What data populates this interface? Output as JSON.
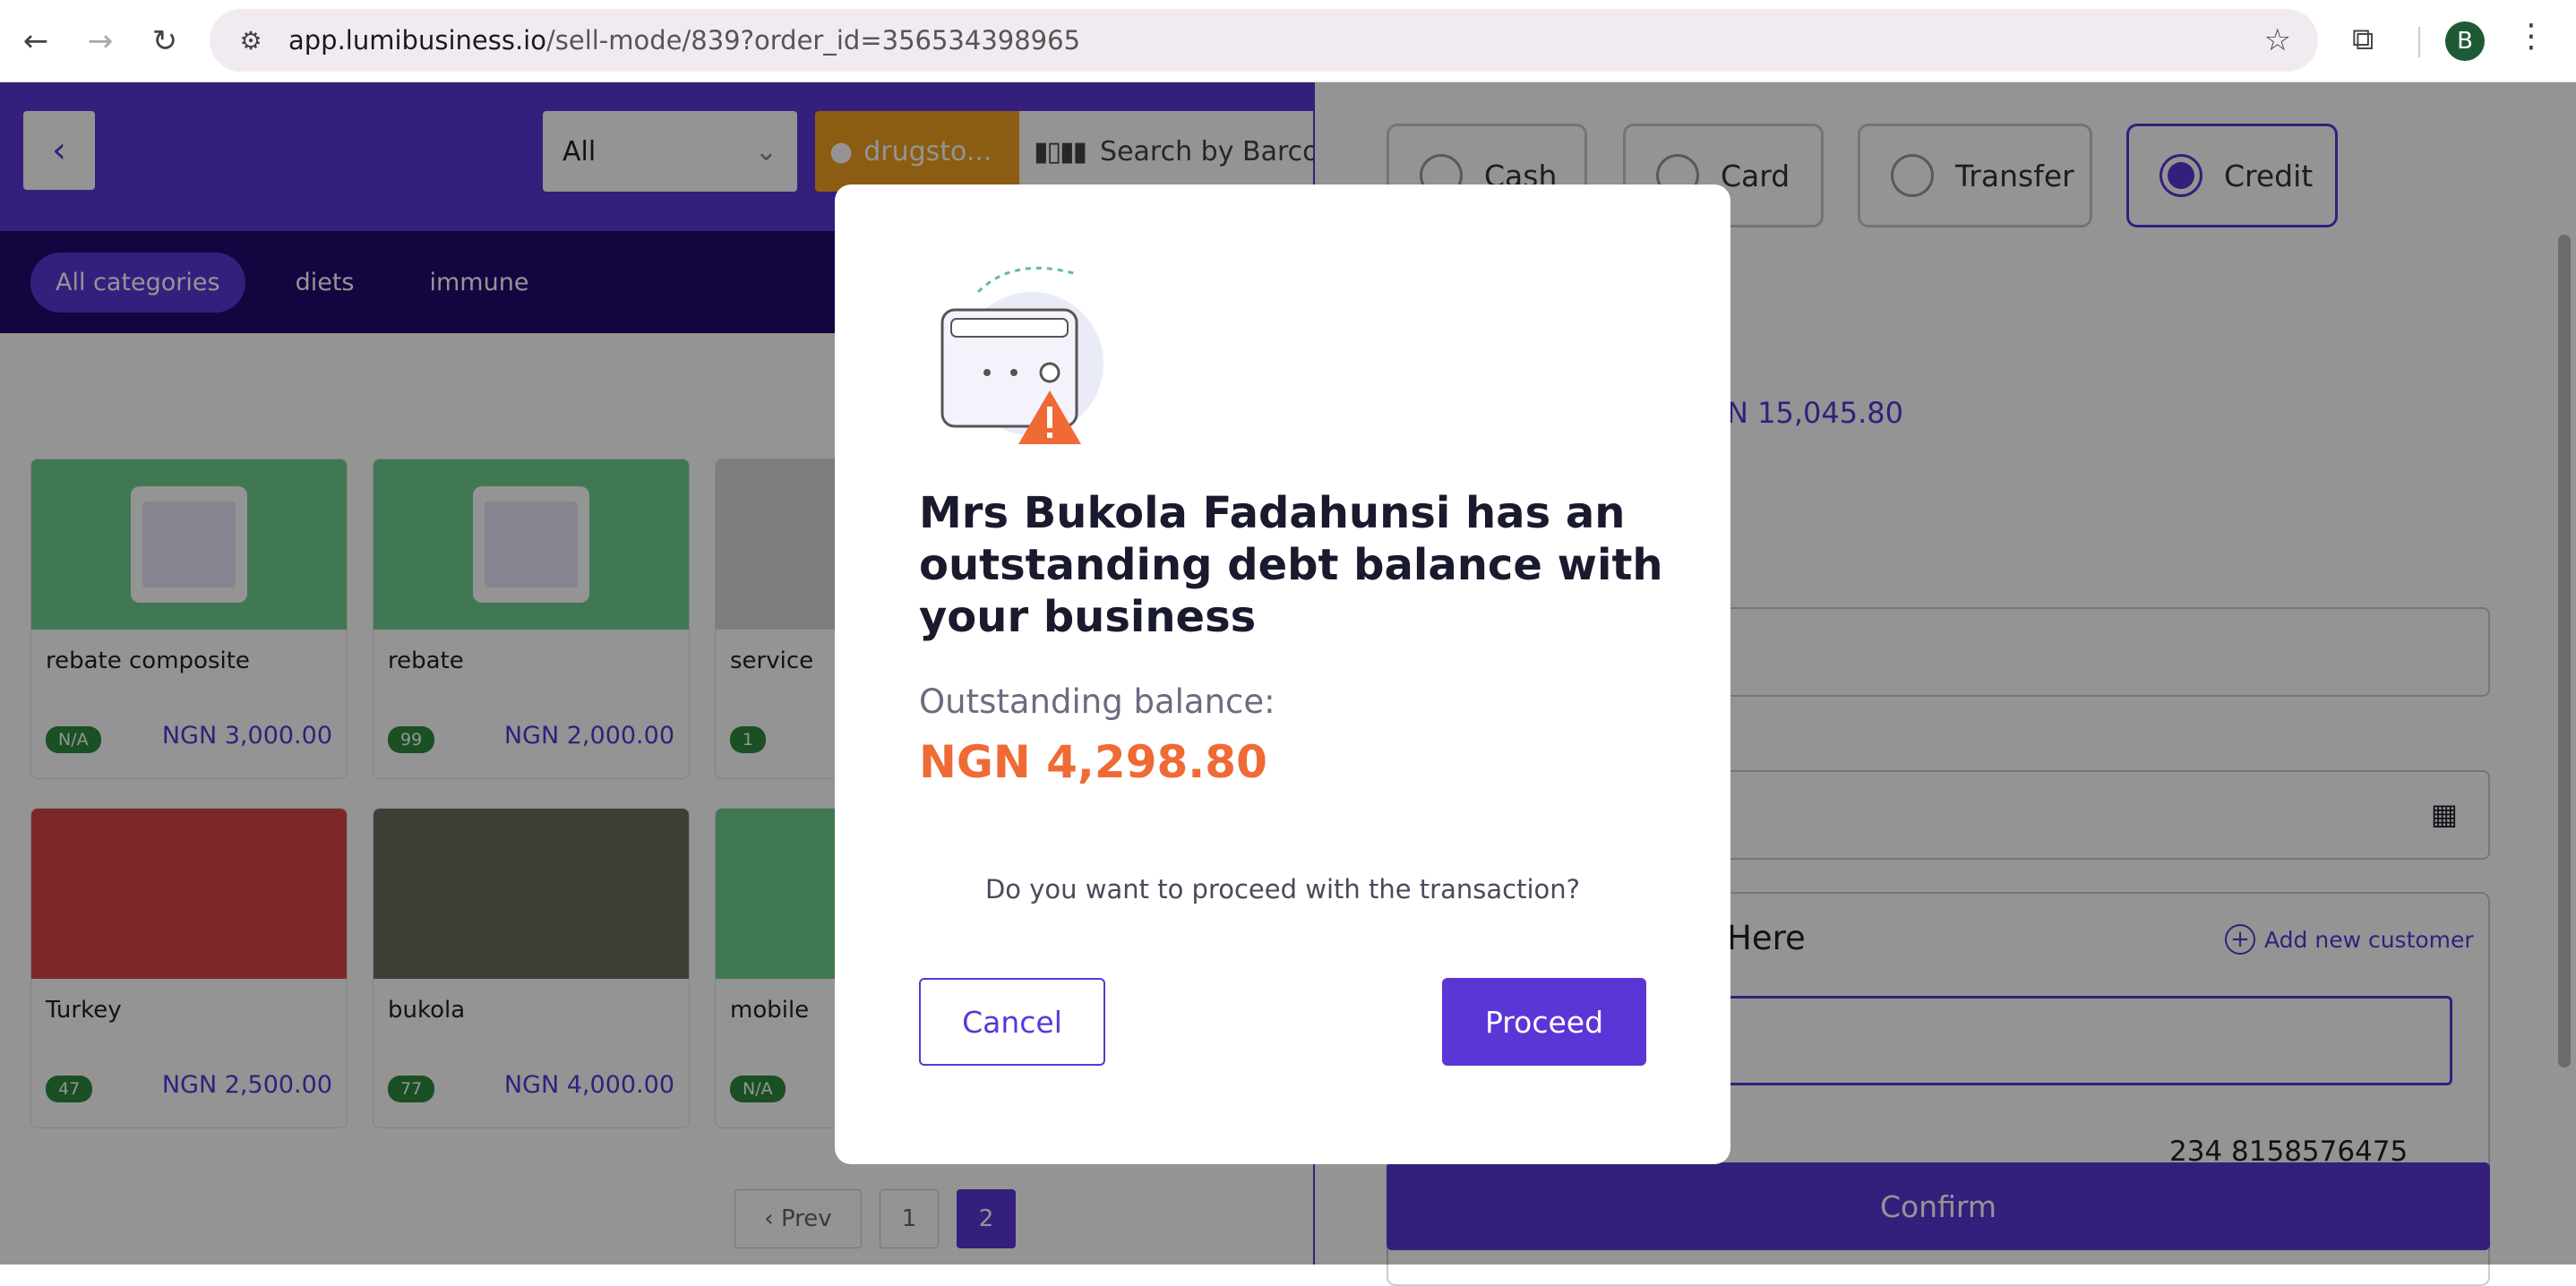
{
  "browser": {
    "url_domain": "app.lumibusiness.io",
    "url_path": "/sell-mode/839?order_id=356534398965",
    "avatar_letter": "B"
  },
  "topbar": {
    "filter_value": "All",
    "location_label": "drugsto...",
    "barcode_placeholder": "Search by Barcode"
  },
  "categories": [
    "All categories",
    "diets",
    "immune"
  ],
  "products": [
    {
      "name": "rebate composite",
      "badge": "N/A",
      "price": "NGN 3,000.00"
    },
    {
      "name": "rebate",
      "badge": "99",
      "price": "NGN 2,000.00"
    },
    {
      "name": "service",
      "badge": "1",
      "price": ""
    },
    {
      "name": "Turkey",
      "badge": "47",
      "price": "NGN 2,500.00"
    },
    {
      "name": "bukola",
      "badge": "77",
      "price": "NGN 4,000.00"
    },
    {
      "name": "mobile",
      "badge": "N/A",
      "price": ""
    }
  ],
  "pagination": {
    "prev": "‹ Prev",
    "pages": [
      "1",
      "2"
    ],
    "current": "2"
  },
  "payment": {
    "methods": [
      "Cash",
      "Card",
      "Transfer",
      "Credit"
    ],
    "selected": "Credit",
    "total_fragment": "N 15,045.80"
  },
  "customer": {
    "title_fragment": "Here",
    "add_new": "Add new customer",
    "phone": "234 8158576475"
  },
  "confirm_label": "Confirm",
  "modal": {
    "title": "Mrs Bukola Fadahunsi has an outstanding debt balance with your business",
    "outstanding_label": "Outstanding balance:",
    "outstanding_value": "NGN 4,298.80",
    "question": "Do you want to proceed with the transaction?",
    "cancel_label": "Cancel",
    "proceed_label": "Proceed"
  },
  "colors": {
    "brand": "#5b36d6",
    "accent": "#ef6a35",
    "stock_badge": "#2e8b3e"
  }
}
